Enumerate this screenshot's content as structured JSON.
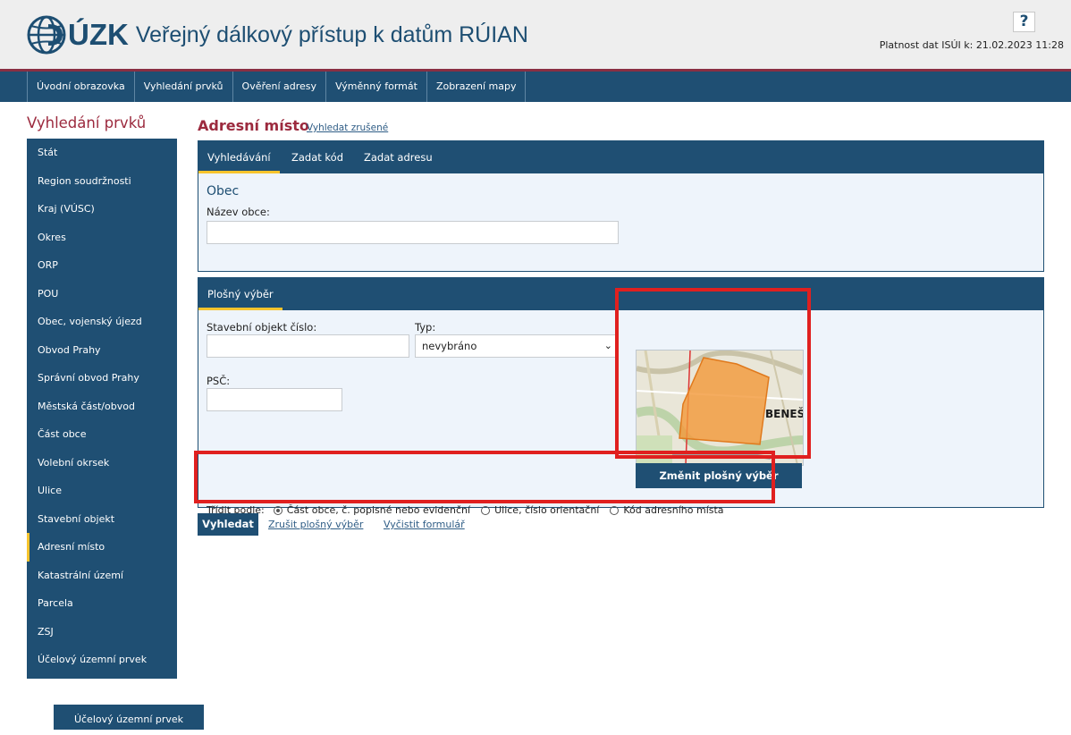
{
  "header": {
    "logo_text": "ÚZK",
    "app_title": "Veřejný dálkový přístup k datům RÚIAN",
    "help_label": "?",
    "validity": "Platnost dat ISÚI k: 21.02.2023 11:28"
  },
  "nav": {
    "items": [
      "Úvodní obrazovka",
      "Vyhledání prvků",
      "Ověření adresy",
      "Výměnný formát",
      "Zobrazení mapy"
    ]
  },
  "sidebar": {
    "title": "Vyhledání prvků",
    "items": [
      "Stát",
      "Region soudržnosti",
      "Kraj (VÚSC)",
      "Okres",
      "ORP",
      "POU",
      "Obec, vojenský újezd",
      "Obvod Prahy",
      "Správní obvod Prahy",
      "Městská část/obvod",
      "Část obce",
      "Volební okrsek",
      "Ulice",
      "Stavební objekt",
      "Adresní místo",
      "Katastrální území",
      "Parcela",
      "ZSJ",
      "Účelový územní prvek"
    ],
    "active_index": 14,
    "floating_button": "Účelový územní prvek"
  },
  "main": {
    "title": "Adresní místo",
    "title_link": "Vyhledat zrušené",
    "tabs": [
      "Vyhledávání",
      "Zadat kód",
      "Zadat adresu"
    ],
    "obec": {
      "heading": "Obec",
      "field_label": "Název obce:",
      "field_value": ""
    },
    "plosny": {
      "tab": "Plošný výběr",
      "stavebni_label": "Stavební objekt číslo:",
      "typ_label": "Typ:",
      "typ_value": "nevybráno",
      "psc_label": "PSČ:",
      "map_label": "BENEŠ",
      "map_button": "Změnit plošný výběr",
      "sort_label": "Třídit podle:",
      "sort_options": [
        "Část obce, č. popisné nebo evidenční",
        "Ulice, číslo orientační",
        "Kód adresního místa"
      ],
      "sort_selected": 0
    },
    "actions": {
      "search": "Vyhledat",
      "clear_area": "Zrušit plošný výběr",
      "clear_form": "Vyčistit formulář"
    }
  },
  "colors": {
    "navy": "#1f4f73",
    "accent": "#f7c42d",
    "title_red": "#9c2a3e",
    "highlight_red": "#e0201f",
    "panel_bg": "#eef4fb",
    "map_orange": "#f39a3c"
  }
}
